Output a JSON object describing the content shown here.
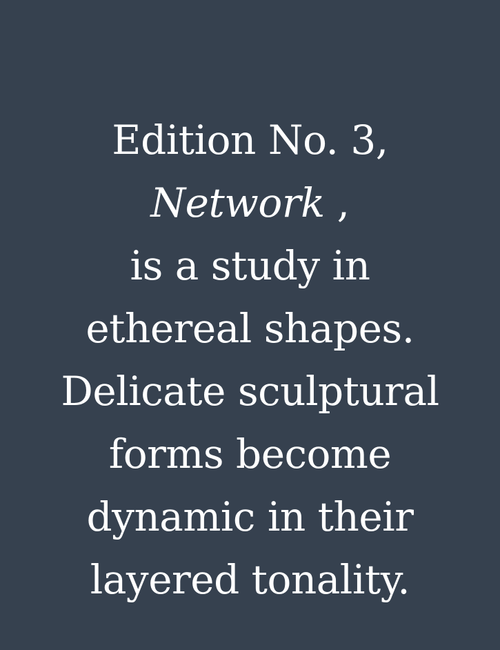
{
  "colors": {
    "background": "#36414f",
    "text": "#ffffff"
  },
  "copy": {
    "line1": "Edition No. 3,",
    "line2_italic": "Network",
    "line2_suffix": " ,",
    "line3": "is a study in",
    "line4": "ethereal shapes.",
    "line5": "Delicate sculptural",
    "line6": "forms become",
    "line7": "dynamic in their",
    "line8": "layered tonality."
  }
}
